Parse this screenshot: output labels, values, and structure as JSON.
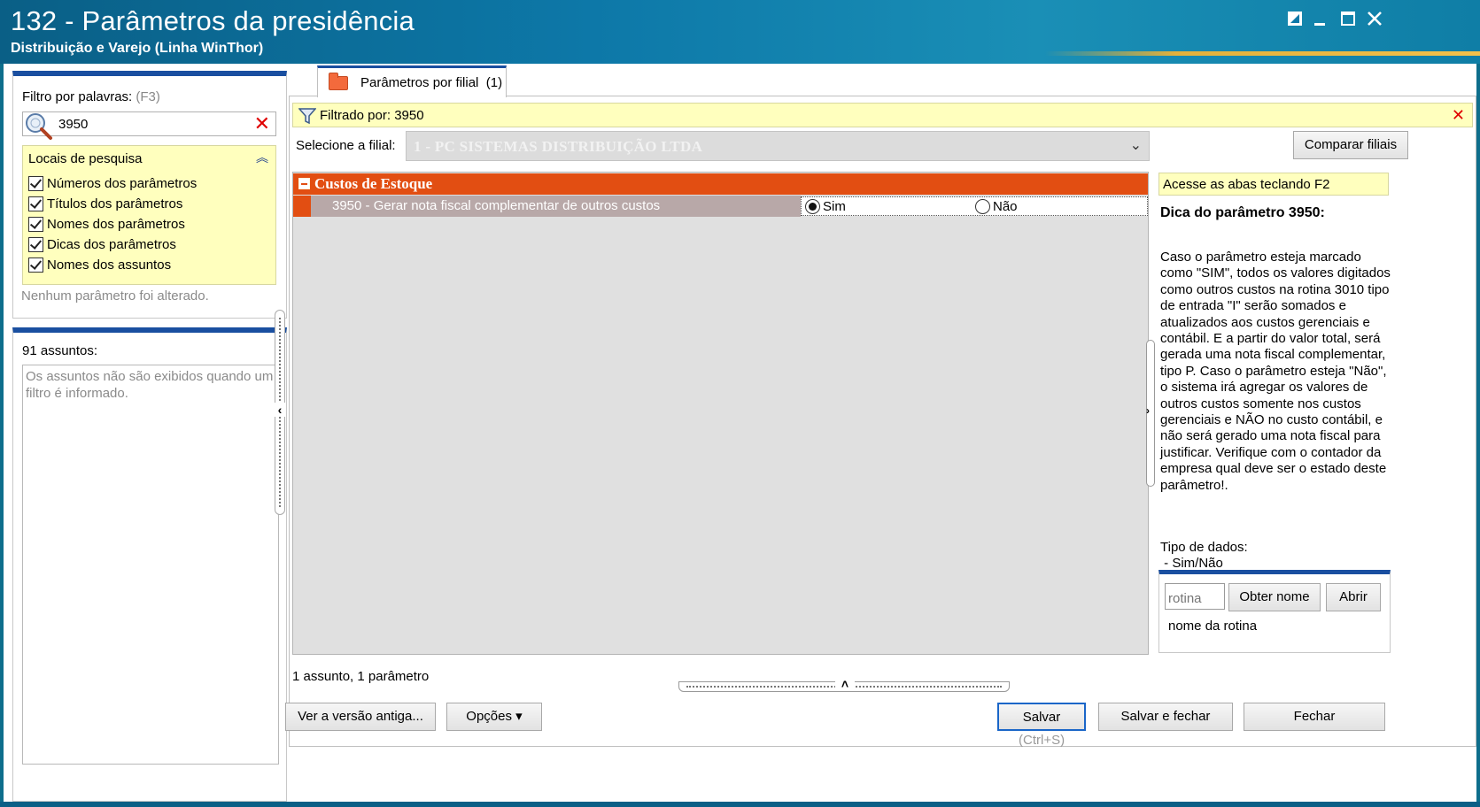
{
  "window": {
    "title": "132 - Parâmetros da presidência",
    "subtitle": "Distribuição e Varejo (Linha WinThor)",
    "controls": [
      "edit-icon",
      "minimize-icon",
      "maximize-icon",
      "close-icon"
    ]
  },
  "filter_panel": {
    "label": "Filtro por palavras:",
    "shortcut": "(F3)",
    "search_value": "3950",
    "locais": {
      "title": "Locais de pesquisa",
      "options": [
        {
          "label": "Números dos parâmetros",
          "checked": true
        },
        {
          "label": "Títulos dos parâmetros",
          "checked": true
        },
        {
          "label": "Nomes dos parâmetros",
          "checked": true
        },
        {
          "label": "Dicas dos parâmetros",
          "checked": true
        },
        {
          "label": "Nomes dos assuntos",
          "checked": true
        }
      ]
    },
    "status": "Nenhum parâmetro foi alterado."
  },
  "assuntos_panel": {
    "label": "91 assuntos:",
    "message": "Os assuntos não são exibidos quando um filtro é informado."
  },
  "tab": {
    "label": "Parâmetros por filial",
    "count": "(1)"
  },
  "filter_bar": {
    "text": "Filtrado por: 3950"
  },
  "filial": {
    "label": "Selecione a filial:",
    "value": "1 - PC SISTEMAS DISTRIBUIÇÃO LTDA",
    "compare_button": "Comparar filiais"
  },
  "grid": {
    "group": "Custos de Estoque",
    "rows": [
      {
        "name": "3950 - Gerar nota fiscal complementar de outros custos",
        "options": [
          "Sim",
          "Não"
        ],
        "selected": "Sim"
      }
    ],
    "status": "1 assunto, 1 parâmetro"
  },
  "hint": {
    "bar": "Acesse as abas teclando F2",
    "title": "Dica do parâmetro 3950:",
    "body": "Caso o parâmetro esteja marcado como \"SIM\", todos os valores digitados como outros custos na rotina 3010 tipo de entrada \"I\" serão somados e atualizados aos custos gerenciais e contábil. E a partir do valor total, será gerada uma nota fiscal complementar, tipo P. Caso o parâmetro esteja \"Não\", o sistema irá agregar os valores de outros custos somente nos custos gerenciais e NÃO no custo contábil, e não será gerado uma nota fiscal para justificar. Verifique com o contador da empresa qual deve ser o estado deste parâmetro!.",
    "tipo_label": "Tipo de dados:",
    "tipo_value": " - Sim/Não"
  },
  "rotina": {
    "placeholder": "rotina",
    "obter_button": "Obter nome",
    "abrir_button": "Abrir",
    "nome_label": "nome da rotina"
  },
  "footer": {
    "versao_button": "Ver a versão antiga...",
    "opcoes_button": "Opções ▾",
    "salvar_button": "Salvar",
    "salvar_shortcut": "(Ctrl+S)",
    "salvar_fechar_button": "Salvar e fechar",
    "fechar_button": "Fechar"
  },
  "colors": {
    "titlebar": "#0d78a8",
    "accent_blue": "#1a4fa0",
    "group_orange": "#e24e12",
    "yellow_panel": "#ffffbe",
    "clear_red": "#e00000"
  }
}
